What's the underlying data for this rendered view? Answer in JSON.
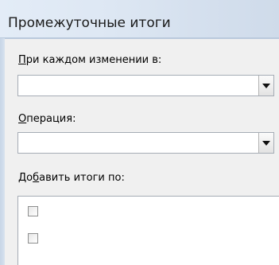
{
  "dialog": {
    "title": "Промежуточные итоги"
  },
  "group_by": {
    "label_accel": "П",
    "label_rest": "ри каждом изменении в:",
    "value": ""
  },
  "operation": {
    "label_accel": "О",
    "label_rest": "перация:",
    "value": ""
  },
  "add_totals": {
    "label_pre": "До",
    "label_accel": "б",
    "label_post": "авить итоги по:",
    "items": [
      {
        "checked": false,
        "label": ""
      },
      {
        "checked": false,
        "label": ""
      }
    ]
  },
  "icons": {
    "dropdown": "chevron-down-icon",
    "checkbox": "checkbox-icon"
  }
}
